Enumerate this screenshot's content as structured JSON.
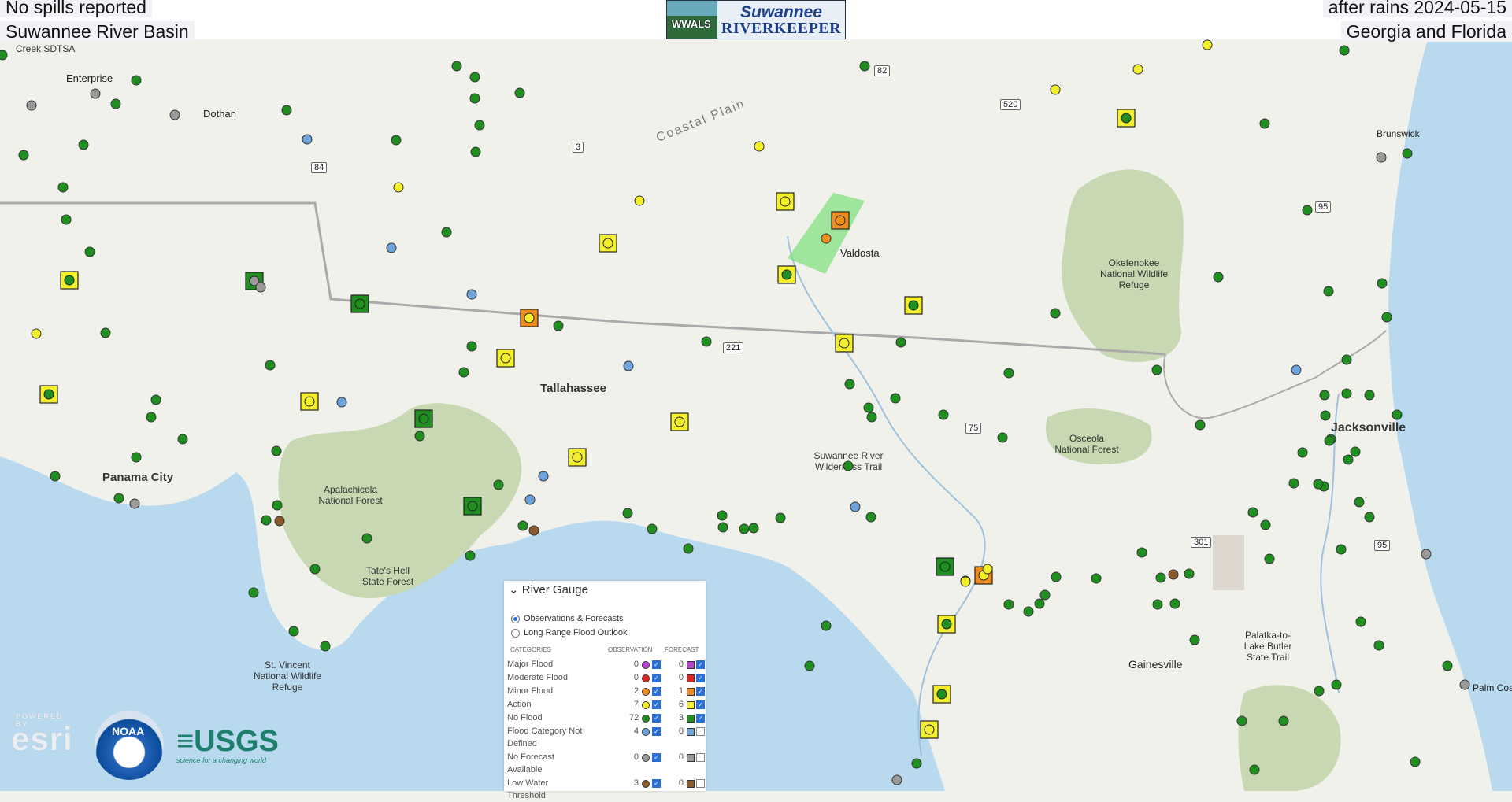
{
  "header": {
    "top_left_1": "No spills reported",
    "top_left_2": "Suwannee River Basin",
    "top_right_1": "after rains 2024-05-15",
    "top_right_2": "Georgia and Florida",
    "logo_line1": "Suwannee",
    "logo_line2": "RIVERKEEPER",
    "logo_badge": "WWALS"
  },
  "map_labels": {
    "cities": [
      "Enterprise",
      "Dothan",
      "Valdosta",
      "Tallahassee",
      "Panama City",
      "Jacksonville",
      "Gainesville",
      "Brunswick",
      "Palm Coast"
    ],
    "places": [
      "Coastal Plain",
      "Okefenokee National Wildlife Refuge",
      "Osceola National Forest",
      "Suwannee River Wilderness Trail",
      "Apalachicola National Forest",
      "Tate's Hell State Forest",
      "St. Vincent National Wildlife Refuge",
      "Palatka-to-Lake Butler State Trail",
      "Creek SDTSA"
    ],
    "routes": [
      "82",
      "520",
      "3",
      "84",
      "95",
      "221",
      "75",
      "301",
      "95"
    ]
  },
  "legend": {
    "title": "River Gauge",
    "option_1": "Observations & Forecasts",
    "option_2": "Long Range Flood Outlook",
    "col_categories": "CATEGORIES",
    "col_observation": "OBSERVATION",
    "col_forecast": "FORECAST",
    "rows": [
      {
        "category": "Major Flood",
        "obs": "0",
        "fc": "0",
        "color": "#b93fd0",
        "obs_checked": true,
        "fc_checked": true
      },
      {
        "category": "Moderate Flood",
        "obs": "0",
        "fc": "0",
        "color": "#e2261d",
        "obs_checked": true,
        "fc_checked": true
      },
      {
        "category": "Minor Flood",
        "obs": "2",
        "fc": "1",
        "color": "#f08c1e",
        "obs_checked": true,
        "fc_checked": true
      },
      {
        "category": "Action",
        "obs": "7",
        "fc": "6",
        "color": "#f4ef2c",
        "obs_checked": true,
        "fc_checked": true
      },
      {
        "category": "No Flood",
        "obs": "72",
        "fc": "3",
        "color": "#1f8f1f",
        "obs_checked": true,
        "fc_checked": true
      },
      {
        "category": "Flood Category Not",
        "category2": "Defined",
        "obs": "4",
        "fc": "0",
        "color": "#6fa3dc",
        "obs_checked": true,
        "fc_checked": false
      },
      {
        "category": "No Forecast",
        "category2": "Available",
        "obs": "0",
        "fc": "0",
        "color": "#9a9a9a",
        "obs_checked": true,
        "fc_checked": false
      },
      {
        "category": "Low Water Threshold",
        "obs": "3",
        "fc": "0",
        "color": "#8a5a2a",
        "obs_checked": true,
        "fc_checked": false
      }
    ]
  },
  "logos": {
    "esri_small": "POWERED BY",
    "esri": "esri",
    "noaa": "NOAA",
    "usgs": "≡USGS",
    "usgs_tag": "science for a changing world"
  },
  "colors": {
    "no_flood": "#1f8f1f",
    "action": "#f4ef2c",
    "minor_flood": "#f08c1e",
    "not_defined": "#6fa3dc",
    "low_water": "#8a5a2a",
    "no_forecast": "#9a9a9a",
    "water": "#b9d9ef",
    "land": "#f1f1ec",
    "forest": "#c7d8b2"
  }
}
